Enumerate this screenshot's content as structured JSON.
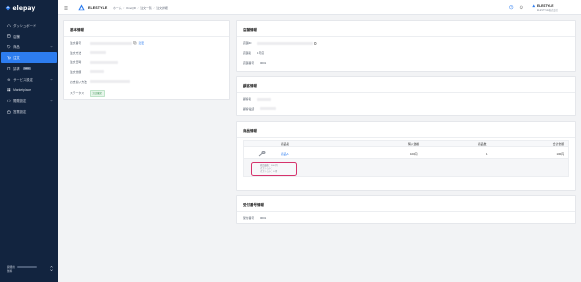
{
  "sidebar": {
    "brand": "elepay",
    "items": [
      {
        "label": "ダッシュボード",
        "icon": "home-icon"
      },
      {
        "label": "店舗",
        "icon": "store-icon"
      },
      {
        "label": "商品",
        "icon": "tag-icon",
        "expandable": true
      },
      {
        "label": "注文",
        "icon": "cart-icon",
        "active": true
      },
      {
        "label": "請求",
        "icon": "invoice-icon",
        "badge": "NEW"
      },
      {
        "label": "サービス設定",
        "icon": "gear-icon",
        "expandable": true
      },
      {
        "label": "Marketplace",
        "icon": "grid-icon"
      },
      {
        "label": "開発設定",
        "icon": "code-icon",
        "expandable": true
      },
      {
        "label": "営業設定",
        "icon": "briefcase-icon"
      }
    ],
    "bottom": {
      "line1": "開発用",
      "line2": "無料"
    }
  },
  "header": {
    "brand": "ELESTYLE",
    "breadcrumbs": [
      "ホーム",
      "OneQR",
      "注文一覧",
      "注文詳細"
    ],
    "user": {
      "name": "ELESTYLE",
      "sub": "ELESTYLE株式会社"
    }
  },
  "basic": {
    "title": "基本情報",
    "fields": [
      {
        "label": "注文番号",
        "link": "変更"
      },
      {
        "label": "注文方法"
      },
      {
        "label": "注文日時"
      },
      {
        "label": "注文金額"
      },
      {
        "label": "お支払い方法"
      },
      {
        "label": "ステータス",
        "status": "注文確定"
      }
    ]
  },
  "store": {
    "title": "店舗情報",
    "fields": [
      {
        "label": "店舗ID",
        "value": "0"
      },
      {
        "label": "店舗名",
        "value": "1号店"
      },
      {
        "label": "店舗番号",
        "value": "0001"
      }
    ]
  },
  "customer": {
    "title": "顧客情報",
    "fields": [
      {
        "label": "顧客名"
      },
      {
        "label": "顧客電話"
      }
    ]
  },
  "products": {
    "title": "商品情報",
    "columns": [
      "商品名",
      "購入価格",
      "商品数",
      "合計金額"
    ],
    "rows": [
      {
        "name": "商品A",
        "price": "100円",
        "qty": "1",
        "total": "100円"
      }
    ],
    "detail": [
      "商品価格：100 円",
      "オプション：",
      "オプション：0 円"
    ]
  },
  "receipt": {
    "title": "受付番号情報",
    "fields": [
      {
        "label": "受付番号",
        "value": "0001"
      }
    ]
  },
  "colors": {
    "sidebar": "#12243f",
    "accent": "#2d7df0",
    "highlight": "#d6336c"
  }
}
